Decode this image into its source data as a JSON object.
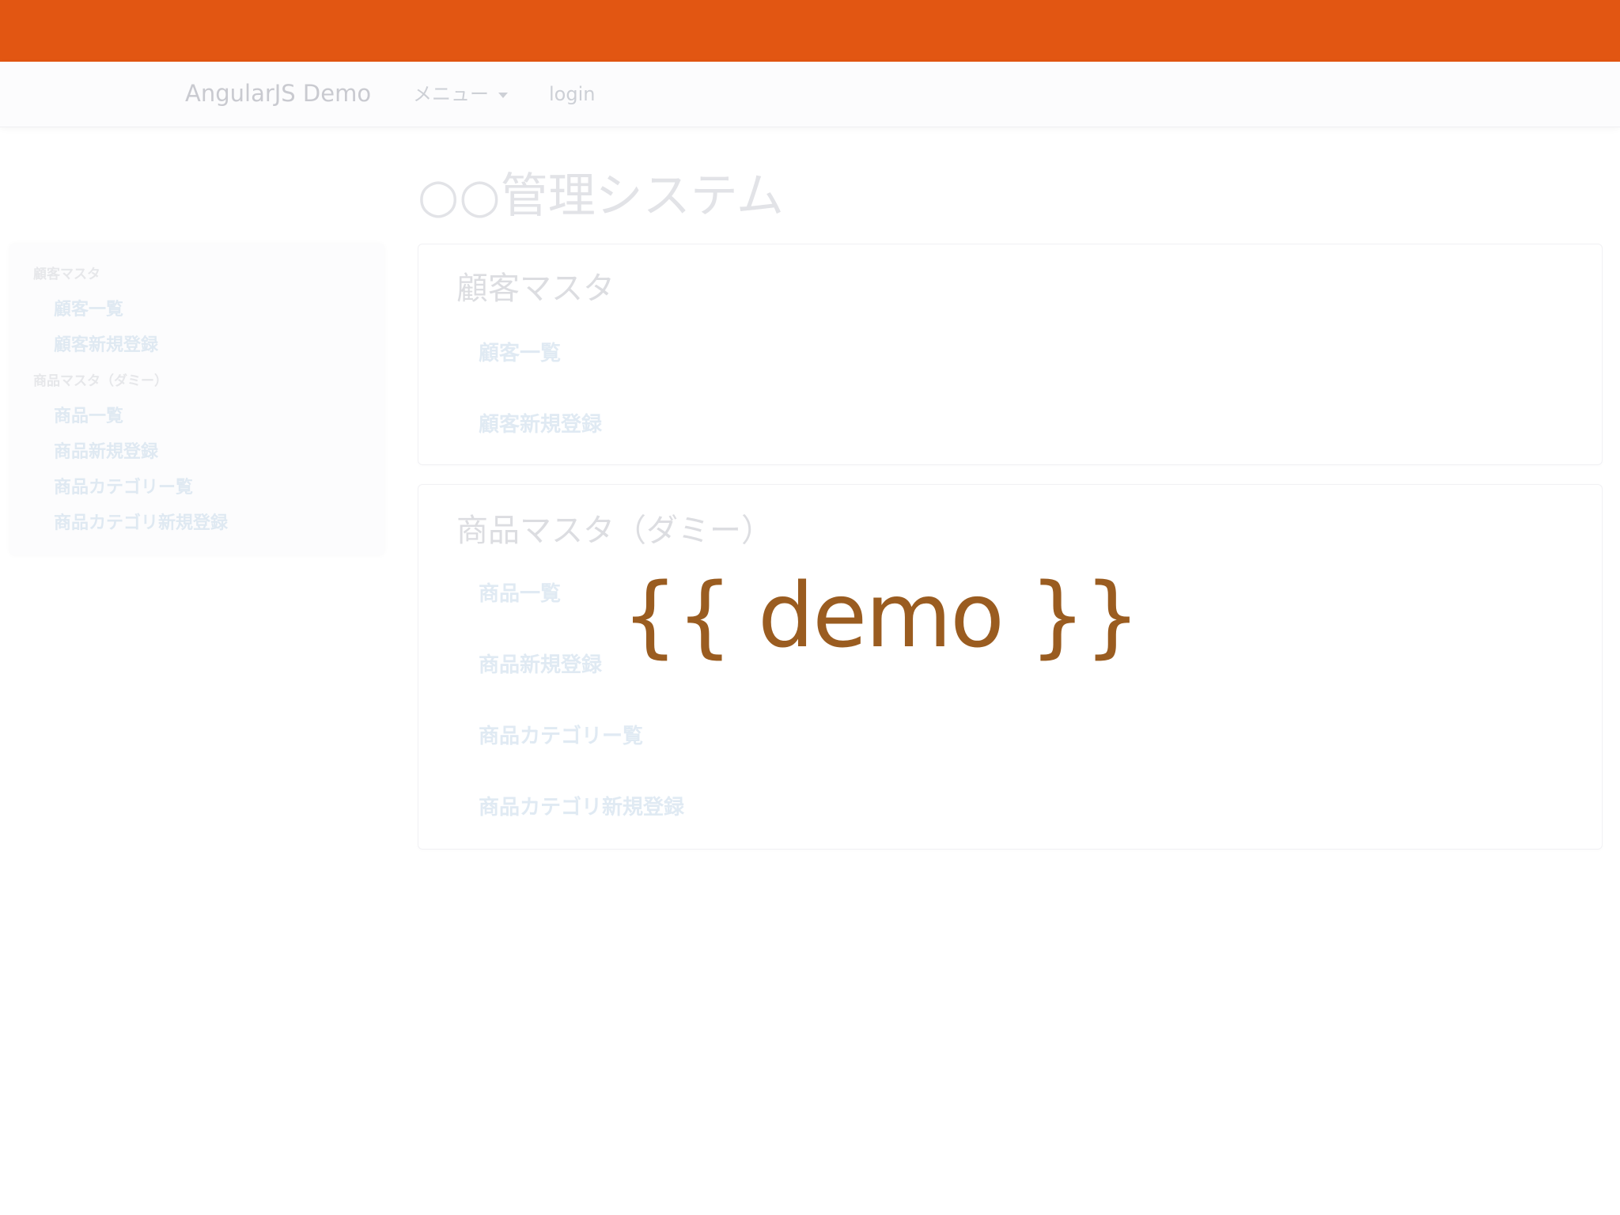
{
  "colors": {
    "top_band": "#e25612",
    "overlay_text": "#9a5c20"
  },
  "navbar": {
    "brand": "AngularJS Demo",
    "menu_label": "メニュー",
    "menu_icon": "caret-down-icon",
    "login_label": "login"
  },
  "page": {
    "title": "○○管理システム"
  },
  "sidebar": {
    "groups": [
      {
        "header": "顧客マスタ",
        "items": [
          "顧客一覧",
          "顧客新規登録"
        ]
      },
      {
        "header": "商品マスタ（ダミー）",
        "items": [
          "商品一覧",
          "商品新規登録",
          "商品カテゴリー覧",
          "商品カテゴリ新規登録"
        ]
      }
    ]
  },
  "panels": [
    {
      "title": "顧客マスタ",
      "links": [
        "顧客一覧",
        "顧客新規登録"
      ]
    },
    {
      "title": "商品マスタ（ダミー）",
      "links": [
        "商品一覧",
        "商品新規登録",
        "商品カテゴリー覧",
        "商品カテゴリ新規登録"
      ]
    }
  ],
  "overlay": {
    "text": "{{ demo }}"
  }
}
